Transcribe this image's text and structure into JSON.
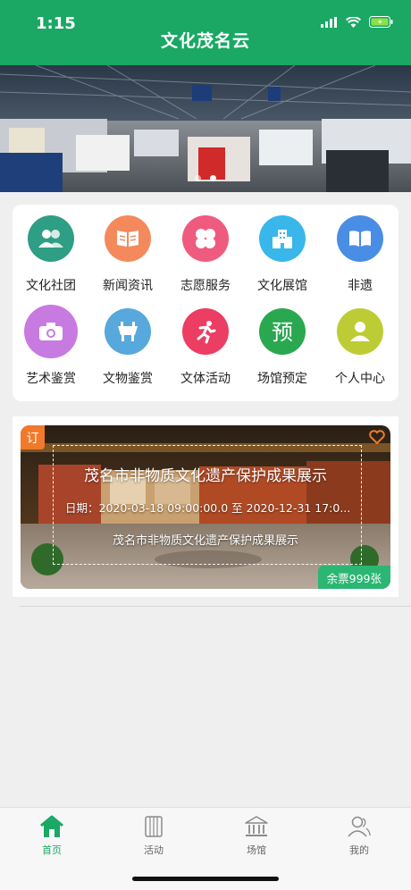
{
  "status_bar": {
    "time": "1:15"
  },
  "header": {
    "title": "文化茂名云"
  },
  "banner": {
    "slide_count": 2,
    "active_slide": 1
  },
  "categories": [
    {
      "label": "文化社团",
      "icon": "group-icon",
      "color": "#2e9e84"
    },
    {
      "label": "新闻资讯",
      "icon": "news-book-icon",
      "color": "#f48a5c"
    },
    {
      "label": "志愿服务",
      "icon": "clover-icon",
      "color": "#ef5b7f"
    },
    {
      "label": "文化展馆",
      "icon": "building-icon",
      "color": "#39b6ea"
    },
    {
      "label": "非遗",
      "icon": "open-book-icon",
      "color": "#4a8de5"
    },
    {
      "label": "艺术鉴赏",
      "icon": "camera-icon",
      "color": "#c77be0"
    },
    {
      "label": "文物鉴赏",
      "icon": "tripod-vessel-icon",
      "color": "#57a8dc"
    },
    {
      "label": "文体活动",
      "icon": "running-icon",
      "color": "#ec3d62"
    },
    {
      "label": "场馆预定",
      "icon": "reserve-char-icon",
      "color": "#2aa84f"
    },
    {
      "label": "个人中心",
      "icon": "person-icon",
      "color": "#bdcc35"
    }
  ],
  "exhibit": {
    "tag": "订",
    "title": "茂名市非物质文化遗产保护成果展示",
    "date": "日期：2020-03-18 09:00:00.0 至 2020-12-31 17:0...",
    "subtitle": "茂名市非物质文化遗产保护成果展示",
    "tickets": "余票999张"
  },
  "tabbar": {
    "active": "home",
    "items": [
      {
        "id": "home",
        "label": "首页",
        "icon": "home-icon"
      },
      {
        "id": "activity",
        "label": "活动",
        "icon": "scroll-icon"
      },
      {
        "id": "venue",
        "label": "场馆",
        "icon": "museum-icon"
      },
      {
        "id": "mine",
        "label": "我的",
        "icon": "user-icon"
      }
    ]
  },
  "colors": {
    "primary": "#1aa864",
    "tag_orange": "#f07a2a",
    "ticket_green": "#2bb673"
  }
}
